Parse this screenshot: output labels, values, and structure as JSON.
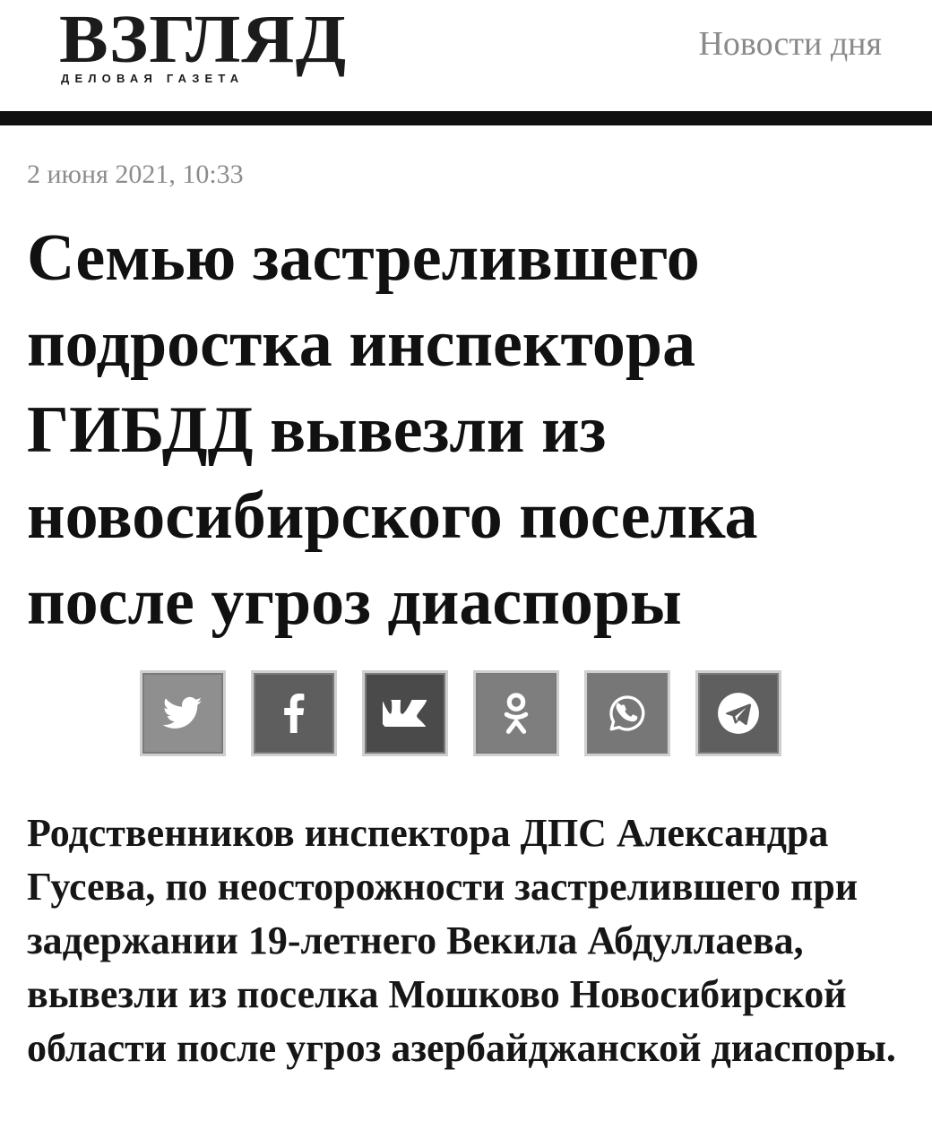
{
  "header": {
    "logo_title": "ВЗГЛЯД",
    "logo_subtitle": "ДЕЛОВАЯ ГАЗЕТА",
    "nav_link": "Новости дня"
  },
  "article": {
    "date": "2 июня 2021, 10:33",
    "headline": "Семью застрелившего подростка инспектора ГИБДД вывезли из новосибирского поселка после угроз диаспоры",
    "lead": "Родственников инспектора ДПС Александра Гусева, по неосторожности застрелившего при задержании 19-летнего Векила Абдуллаева, вывезли из поселка Мошково Новосибирской области после угроз азербайджанской диаспоры."
  },
  "share": {
    "buttons": [
      {
        "icon": "twitter-icon",
        "color": "#8f8f8f"
      },
      {
        "icon": "facebook-icon",
        "color": "#5e5e5e"
      },
      {
        "icon": "vk-icon",
        "color": "#4a4a4a"
      },
      {
        "icon": "odnoklassniki-icon",
        "color": "#7e7e7e"
      },
      {
        "icon": "whatsapp-icon",
        "color": "#777777"
      },
      {
        "icon": "telegram-icon",
        "color": "#5f5f5f"
      }
    ]
  }
}
